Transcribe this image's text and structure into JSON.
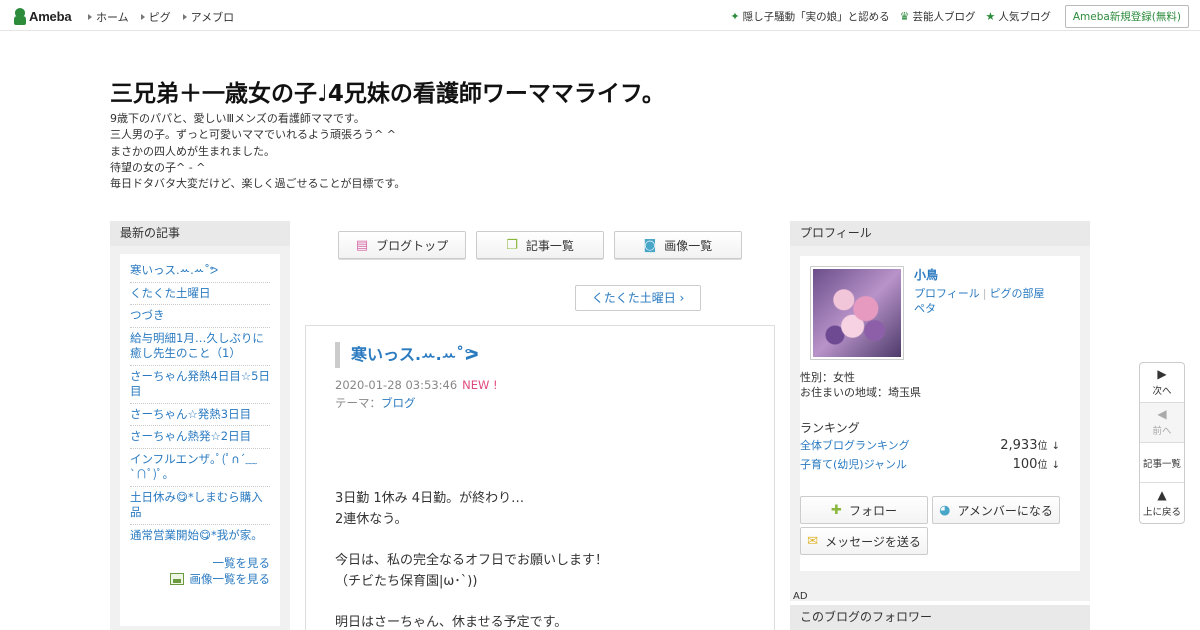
{
  "header": {
    "logo_text": "Ameba",
    "nav": [
      "ホーム",
      "ピグ",
      "アメブロ"
    ],
    "right_links": [
      {
        "icon": "sparkle-icon",
        "label": "隠し子騒動「実の娘」と認める"
      },
      {
        "icon": "crown-icon",
        "label": "芸能人ブログ"
      },
      {
        "icon": "star-icon",
        "label": "人気ブログ"
      }
    ],
    "signup_label": "Ameba新規登録(無料)"
  },
  "blog": {
    "title": "三兄弟＋一歳女の子♩4兄妹の看護師ワーママライフ。",
    "description": [
      "9歳下のパパと、愛しいⅢメンズの看護師ママです。",
      "三人男の子。ずっと可愛いママでいれるよう頑張ろう^ ^",
      "まさかの四人めが生まれました。",
      "待望の女の子^ - ^",
      "毎日ドタバタ大変だけど、楽しく過ごせることが目標です。"
    ]
  },
  "left_sidebar": {
    "heading": "最新の記事",
    "items": [
      "寒いっス.ꕀ.ꕀ˚ᕗ",
      "くたくた土曜日",
      "つづき",
      "給与明細1月…久しぶりに癒し先生のこと（1）",
      "さーちゃん発熱4日目☆5日目",
      "さーちゃん☆発熱3日目",
      "さーちゃん熱発☆2日目",
      "インフルエンザ｡ﾟ(ﾟ∩´﹏`∩ﾟ)ﾟ｡",
      "土日休み😋*しまむら購入品",
      "通常営業開始😋*我が家。"
    ],
    "more_label": "一覧を見る",
    "images_label": "画像一覧を見る"
  },
  "center": {
    "buttons": [
      {
        "icon": "document-icon",
        "label": "ブログトップ"
      },
      {
        "icon": "list-icon",
        "label": "記事一覧"
      },
      {
        "icon": "camera-icon",
        "label": "画像一覧"
      }
    ],
    "next_post": "くたくた土曜日 ›",
    "article": {
      "title": "寒いっス.ꕀ.ꕀ˚ᕗ",
      "date": "2020-01-28 03:53:46",
      "new_badge": "NEW !",
      "theme_prefix": "テーマ：",
      "theme": "ブログ",
      "body": "3日勤 1休み 4日勤。が終わり…\n2連休なう。\n\n今日は、私の完全なるオフ日でお願いします！\n（チビたち保育園|ω･`))\n\n明日はさーちゃん、休ませる予定です。"
    }
  },
  "profile": {
    "heading": "プロフィール",
    "name": "小鳥",
    "link_profile": "プロフィール",
    "link_pig": "ピグの部屋",
    "link_peta": "ペタ",
    "gender": "性別：女性",
    "region": "お住まいの地域：埼玉県",
    "ranking_heading": "ランキング",
    "rankings": [
      {
        "label": "全体ブログランキング",
        "value": "2,933",
        "unit": "位",
        "arrow": "↓"
      },
      {
        "label": "子育て(幼児)ジャンル",
        "value": "100",
        "unit": "位",
        "arrow": "↓"
      }
    ],
    "follow_label": "フォロー",
    "amember_label": "アメンバーになる",
    "message_label": "メッセージを送る"
  },
  "ad_label": "AD",
  "follower_heading": "このブログのフォロワー",
  "float_nav": {
    "next": "次へ",
    "prev": "前へ",
    "list": "記事一覧",
    "top": "上に戻る"
  },
  "colors": {
    "brand_green": "#2d8c3c",
    "link_blue": "#2a7ac0",
    "new_pink": "#e0497f"
  }
}
